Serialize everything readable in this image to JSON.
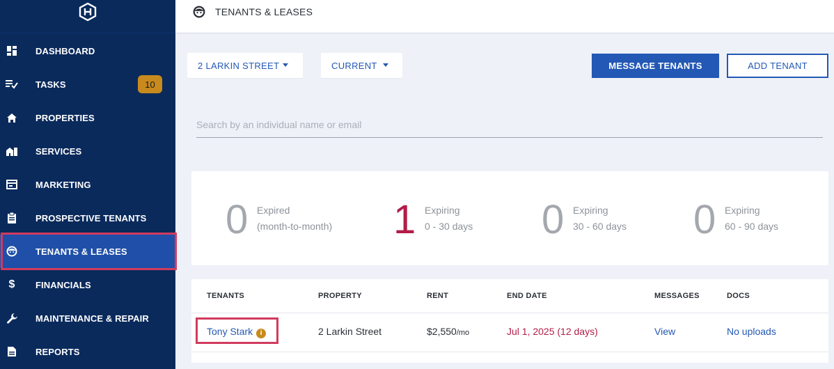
{
  "header": {
    "title": "TENANTS & LEASES",
    "icon": "face-icon"
  },
  "sidebar": {
    "logo": "house-logo-icon",
    "items": [
      {
        "label": "DASHBOARD",
        "icon": "dashboard-icon"
      },
      {
        "label": "TASKS",
        "icon": "tasks-icon",
        "badge": "10"
      },
      {
        "label": "PROPERTIES",
        "icon": "home-icon"
      },
      {
        "label": "SERVICES",
        "icon": "services-icon"
      },
      {
        "label": "MARKETING",
        "icon": "marketing-icon"
      },
      {
        "label": "PROSPECTIVE TENANTS",
        "icon": "clipboard-icon"
      },
      {
        "label": "TENANTS & LEASES",
        "icon": "face-icon",
        "active": true
      },
      {
        "label": "FINANCIALS",
        "icon": "dollar-icon"
      },
      {
        "label": "MAINTENANCE & REPAIR",
        "icon": "wrench-icon"
      },
      {
        "label": "REPORTS",
        "icon": "report-icon"
      }
    ]
  },
  "filters": {
    "property": "2 LARKIN STREET",
    "status": "CURRENT"
  },
  "actions": {
    "message": "MESSAGE TENANTS",
    "add": "ADD TENANT"
  },
  "search": {
    "placeholder": "Search by an individual name or email",
    "value": ""
  },
  "stats": [
    {
      "count": "0",
      "line1": "Expired",
      "line2": "(month-to-month)"
    },
    {
      "count": "1",
      "line1": "Expiring",
      "line2": "0 - 30 days",
      "highlight": true
    },
    {
      "count": "0",
      "line1": "Expiring",
      "line2": "30 - 60 days"
    },
    {
      "count": "0",
      "line1": "Expiring",
      "line2": "60 - 90 days"
    }
  ],
  "table": {
    "headers": [
      "TENANTS",
      "PROPERTY",
      "RENT",
      "END DATE",
      "MESSAGES",
      "DOCS"
    ],
    "rows": [
      {
        "tenant": "Tony Stark",
        "property": "2 Larkin Street",
        "rent": "$2,550",
        "rent_unit": "/mo",
        "end_date": "Jul 1, 2025 (12 days)",
        "messages": "View",
        "docs": "No uploads"
      }
    ]
  },
  "colors": {
    "sidebar": "#0a2a5c",
    "active": "#1f4fa8",
    "accent": "#2358b4",
    "alert": "#b21d48",
    "badge": "#c88a1c"
  }
}
